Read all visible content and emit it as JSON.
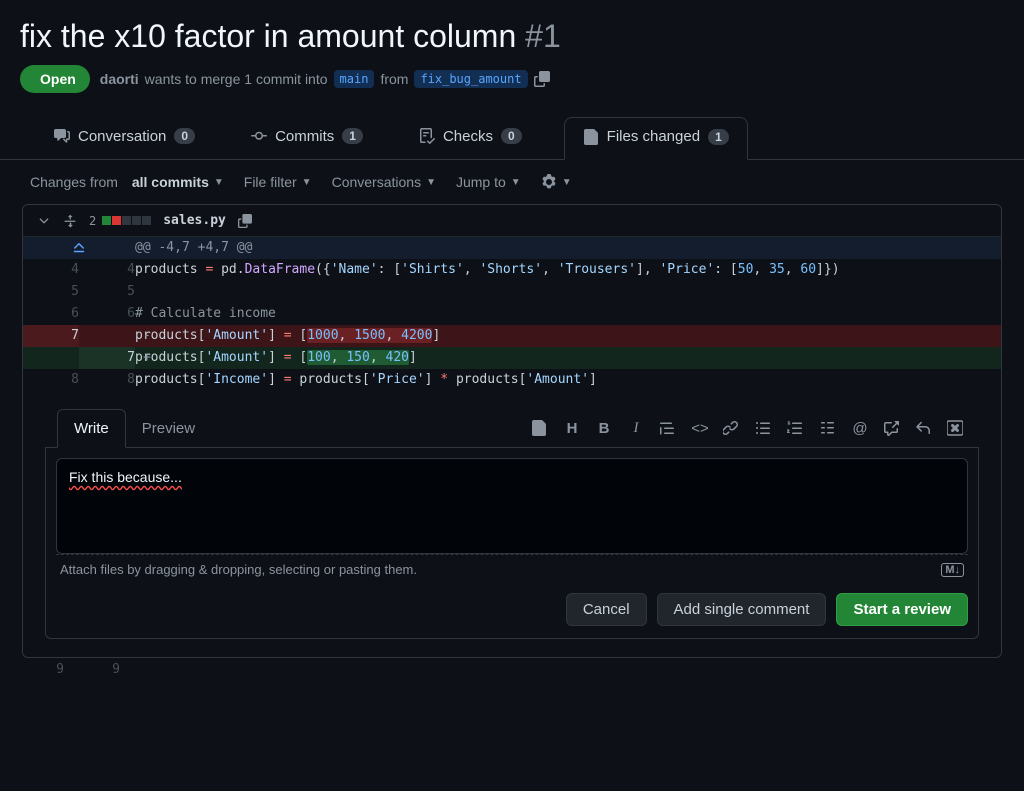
{
  "pr": {
    "title": "fix the x10 factor in amount column",
    "number": "#1",
    "state": "Open",
    "author": "daorti",
    "desc_before": "wants to merge 1 commit into",
    "base_branch": "main",
    "desc_mid": "from",
    "head_branch": "fix_bug_amount"
  },
  "tabs": {
    "conversation": {
      "label": "Conversation",
      "count": "0"
    },
    "commits": {
      "label": "Commits",
      "count": "1"
    },
    "checks": {
      "label": "Checks",
      "count": "0"
    },
    "files": {
      "label": "Files changed",
      "count": "1"
    }
  },
  "toolbar": {
    "changes_pre": "Changes from",
    "changes_from": "all commits",
    "file_filter": "File filter",
    "conversations": "Conversations",
    "jump_to": "Jump to"
  },
  "file": {
    "name": "sales.py",
    "stat": "2",
    "hunk": "@@ -4,7 +4,7 @@"
  },
  "diff": {
    "l4_old": "4",
    "l4_new": "4",
    "l5_old": "5",
    "l5_new": "5",
    "l6_old": "6",
    "l6_new": "6",
    "l7_old": "7",
    "l7_new": "7",
    "l8_old": "8",
    "l8_new": "8",
    "l9_old": "9",
    "l9_new": "9"
  },
  "comment": {
    "write": "Write",
    "preview": "Preview",
    "value": "Fix this because...",
    "attach": "Attach files by dragging & dropping, selecting or pasting them.",
    "cancel": "Cancel",
    "add_single": "Add single comment",
    "start_review": "Start a review"
  }
}
